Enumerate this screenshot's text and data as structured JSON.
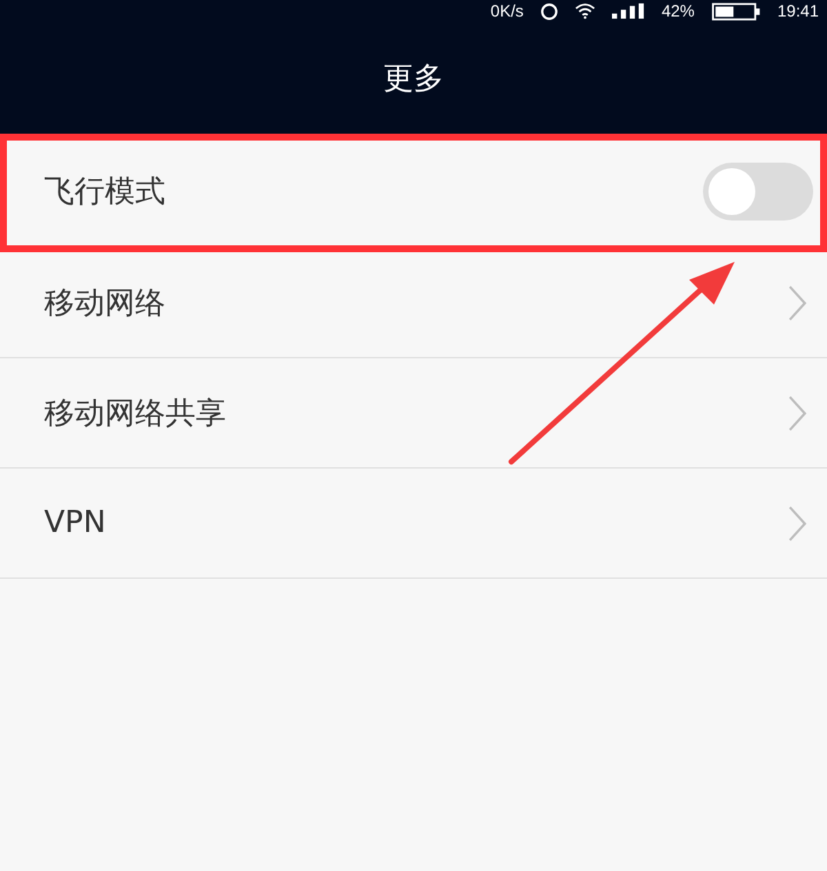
{
  "status_bar": {
    "speed": "0K/s",
    "battery": "42%",
    "time": "19:41"
  },
  "header": {
    "title": "更多"
  },
  "items": [
    {
      "kind": "toggle",
      "label": "飞行模式",
      "on": false,
      "highlighted": true
    },
    {
      "kind": "link",
      "label": "移动网络",
      "highlighted": false
    },
    {
      "kind": "link",
      "label": "移动网络共享",
      "highlighted": false
    },
    {
      "kind": "link",
      "label": "VPN",
      "highlighted": false
    }
  ]
}
